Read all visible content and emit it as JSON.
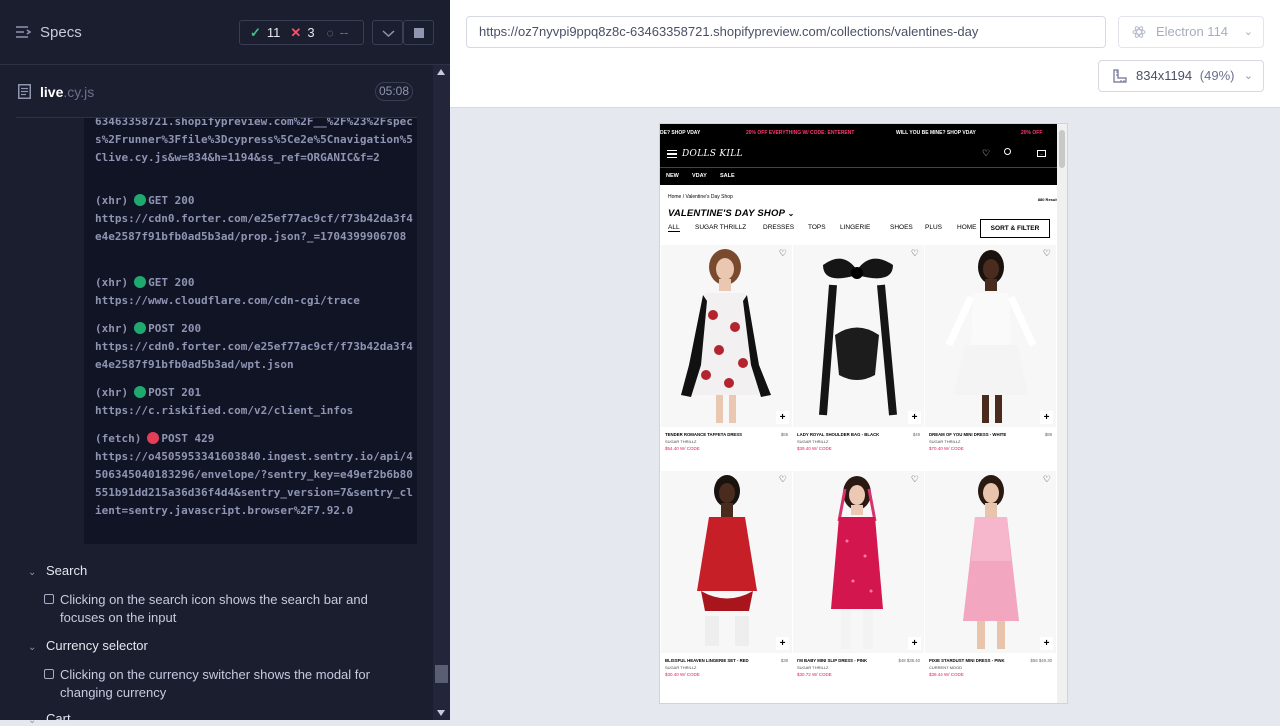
{
  "sidebar": {
    "title": "Specs",
    "stats": {
      "passed": "11",
      "failed": "3",
      "pending": "--"
    },
    "file": {
      "name": "live",
      "ext": ".cy.js",
      "duration": "05:08"
    },
    "log": [
      {
        "url": "63463358721.shopifypreview.com%2F__%2F%23%2Fspecs%2Frunner%3Ffile%3Dcypress%5Ce2e%5Cnavigation%5Clive.cy.js&w=834&h=1194&ss_ref=ORGANIC&f=2"
      },
      {
        "type": "(xhr)",
        "status_color": "#1fa971",
        "method": "GET 200",
        "url": "https://cdn0.forter.com/e25ef77ac9cf/f73b42da3f4e4e2587f91bfb0ad5b3ad/prop.json?_=1704399906708"
      },
      {
        "type": "(xhr)",
        "status_color": "#1fa971",
        "method": "GET 200",
        "url": "https://www.cloudflare.com/cdn-cgi/trace"
      },
      {
        "type": "(xhr)",
        "status_color": "#1fa971",
        "method": "POST 200",
        "url": "https://cdn0.forter.com/e25ef77ac9cf/f73b42da3f4e4e2587f91bfb0ad5b3ad/wpt.json"
      },
      {
        "type": "(xhr)",
        "status_color": "#1fa971",
        "method": "POST 201",
        "url": "https://c.riskified.com/v2/client_infos"
      },
      {
        "type": "(fetch)",
        "status_color": "#e23e57",
        "method": "POST 429",
        "url": "https://o4505953341603840.ingest.sentry.io/api/4506345040183296/envelope/?sentry_key=e49ef2b6b80551b91dd215a36d36f4d4&sentry_version=7&sentry_client=sentry.javascript.browser%2F7.92.0"
      }
    ],
    "suites": [
      {
        "title": "Search",
        "test": "Clicking on the search icon shows the search bar and focuses on the input"
      },
      {
        "title": "Currency selector",
        "test": "Clicking on the currency switcher shows the modal for changing currency"
      },
      {
        "title": "Cart"
      }
    ]
  },
  "topbar": {
    "url": "https://oz7nyvpi9ppq8z8c-63463358721.shopifypreview.com/collections/valentines-day",
    "browser": "Electron 114",
    "viewport": "834x1194",
    "scale": "(49%)"
  },
  "shop": {
    "promo": [
      "DE? SHOP VDAY",
      "20% OFF EVERYTHING W/ CODE: ENTERENT",
      "WILL YOU BE MINE? SHOP VDAY",
      "20% OFF"
    ],
    "logo": "DOLLS KILL",
    "nav": [
      "NEW",
      "VDAY",
      "SALE"
    ],
    "breadcrumb": "Home / Valentine's Day Shop",
    "results": "880 Results",
    "title": "VALENTINE'S DAY SHOP",
    "categories": [
      "ALL",
      "SUGAR THRILLZ",
      "DRESSES",
      "TOPS",
      "LINGERIE",
      "SHOES",
      "PLUS",
      "HOME"
    ],
    "sort_label": "SORT & FILTER",
    "products": [
      {
        "name": "TENDER ROMANCE TAFFETA DRESS",
        "brand": "SUGAR THRILLZ",
        "price": "$54.40 W/ CODE",
        "orig": "$68"
      },
      {
        "name": "LADY ROYAL SHOULDER BAG - BLACK",
        "brand": "SUGAR THRILLZ",
        "price": "$39.40 W/ CODE",
        "orig": "$49"
      },
      {
        "name": "DREAM OF YOU MINI DRESS - WHITE",
        "brand": "SUGAR THRILLZ",
        "price": "$70.40 W/ CODE",
        "orig": "$88"
      },
      {
        "name": "BLISSFUL HEAVEN LINGERIE SET - RED",
        "brand": "SUGAR THRILLZ",
        "price": "$30.40 W/ CODE",
        "orig": "$38"
      },
      {
        "name": "I'M BABY MINI SLIP DRESS - PINK",
        "brand": "SUGAR THRILLZ",
        "price": "$30.72 W/ CODE",
        "orig": "$48 $38.40"
      },
      {
        "name": "PIXIE STARDUST MINI DRESS - PINK",
        "brand": "CURRENT MOOD",
        "price": "$39.44 W/ CODE",
        "orig": "$58 $49.30"
      }
    ]
  }
}
